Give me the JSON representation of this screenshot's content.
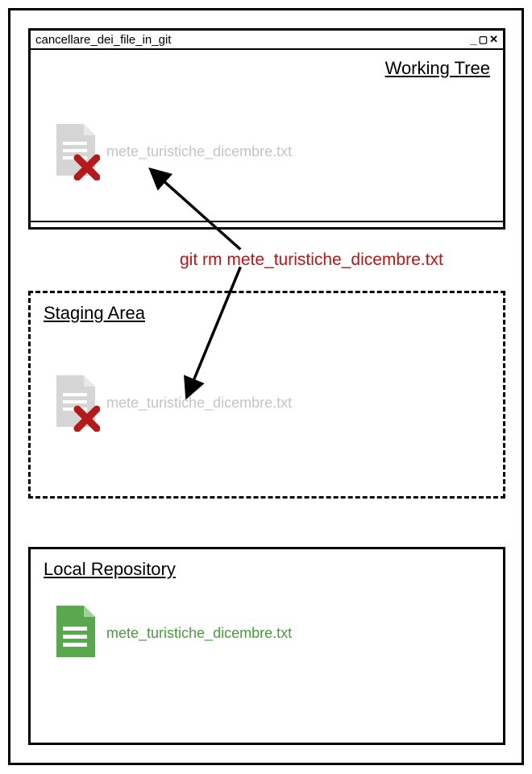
{
  "window": {
    "title": "cancellare_dei_file_in_git",
    "controls": {
      "minimize": "_",
      "maximize": "▢",
      "close": "✕"
    }
  },
  "working_tree": {
    "title": "Working Tree",
    "file_name": "mete_turistiche_dicembre.txt",
    "deleted": true
  },
  "staging_area": {
    "title": "Staging Area",
    "file_name": "mete_turistiche_dicembre.txt",
    "deleted": true
  },
  "local_repository": {
    "title": "Local Repository",
    "file_name": "mete_turistiche_dicembre.txt",
    "deleted": false
  },
  "command": "git rm mete_turistiche_dicembre.txt",
  "colors": {
    "deleted_file": "#d5d5d5",
    "deleted_mark": "#b51919",
    "command": "#c21212",
    "green_file": "#5aa84e",
    "green_text": "#4a9a3f"
  }
}
